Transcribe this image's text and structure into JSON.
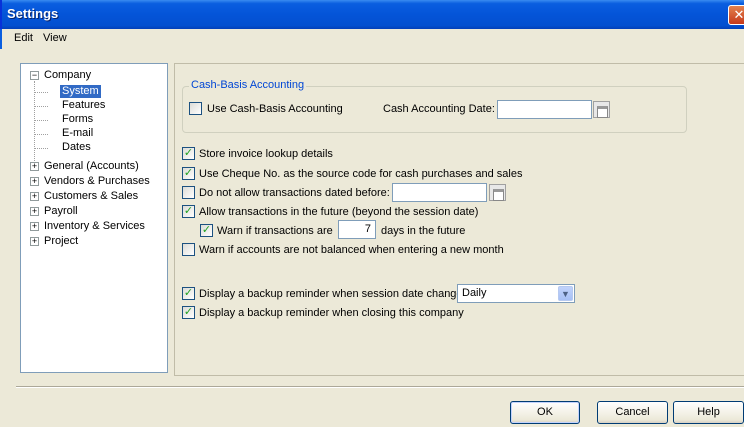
{
  "window": {
    "title": "Settings",
    "close_glyph": "✕",
    "accent_color": "#0454d8"
  },
  "menu": [
    "Edit",
    "View"
  ],
  "tree": {
    "company": "Company",
    "children": [
      "System",
      "Features",
      "Forms",
      "E-mail",
      "Dates"
    ],
    "selected": "System",
    "roots": [
      "General (Accounts)",
      "Vendors & Purchases",
      "Customers & Sales",
      "Payroll",
      "Inventory & Services",
      "Project"
    ]
  },
  "cash_basis": {
    "group_title": "Cash-Basis Accounting",
    "use_label": "Use Cash-Basis Accounting",
    "use_checked": false,
    "date_label": "Cash Accounting Date:",
    "date_value": ""
  },
  "options": {
    "store_invoice": "Store invoice lookup details",
    "use_cheque": "Use Cheque No. as the source code for cash purchases and sales",
    "no_before": "Do not allow transactions dated before:",
    "no_before_value": "",
    "allow_future": "Allow transactions in the future (beyond the session date)",
    "warn_future": "Warn if transactions are",
    "warn_days": "7",
    "days_future": "days in the future",
    "warn_balance": "Warn if accounts are not balanced when entering a new month",
    "backup_change": "Display a backup reminder when session date changes",
    "backup_frequency": "Daily",
    "backup_closing": "Display a backup reminder when closing this company"
  },
  "buttons": {
    "ok": "OK",
    "cancel": "Cancel",
    "help": "Help"
  }
}
